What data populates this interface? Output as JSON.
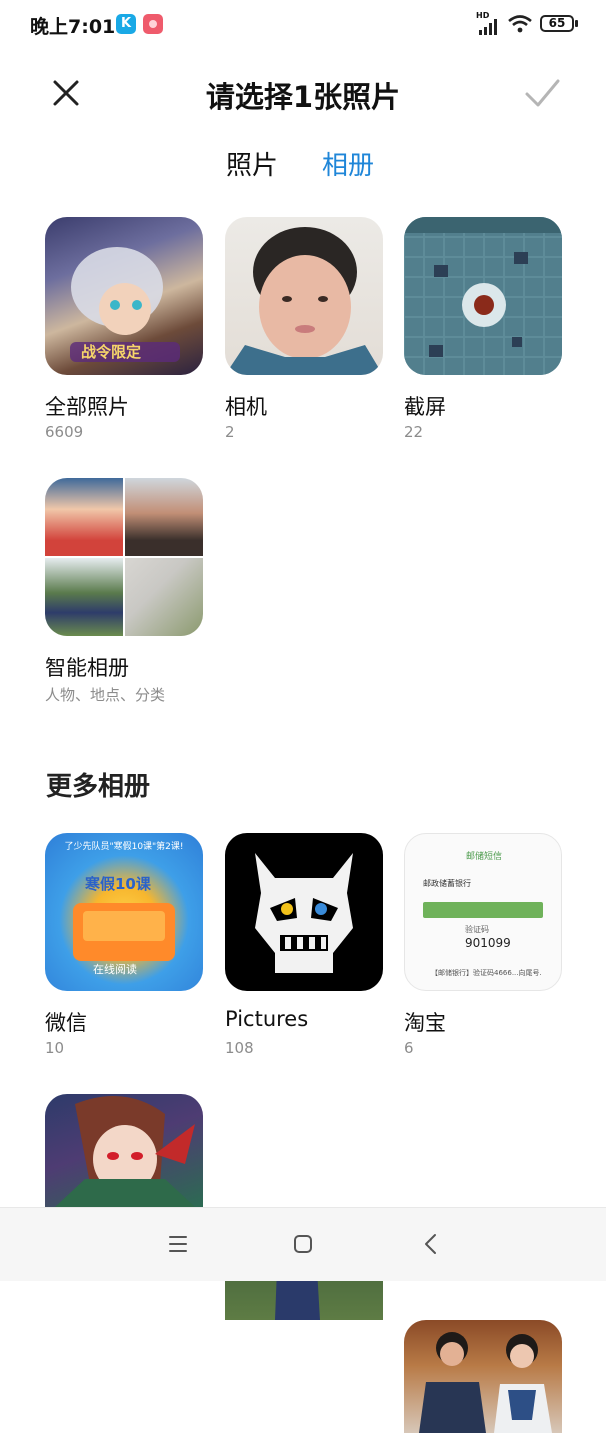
{
  "status_bar": {
    "time": "晚上7:01",
    "app_k_label": "K",
    "network": "HD",
    "battery": "65"
  },
  "header": {
    "title": "请选择1张照片"
  },
  "tabs": {
    "photos": "照片",
    "albums": "相册",
    "active": "相册"
  },
  "albums": [
    {
      "name": "全部照片",
      "count": "6609"
    },
    {
      "name": "相机",
      "count": "2"
    },
    {
      "name": "截屏",
      "count": "22"
    },
    {
      "name": "智能相册",
      "count": "人物、地点、分类"
    }
  ],
  "more_albums": {
    "title": "更多相册",
    "items": [
      {
        "name": "微信",
        "count": "10"
      },
      {
        "name": "Pictures",
        "count": "108"
      },
      {
        "name": "淘宝",
        "count": "6"
      }
    ]
  },
  "thumb_text": {
    "all_banner": "战令限定",
    "wechat_top": "了少先队员\"寒假10课\"第2课!",
    "wechat_badge": "寒假10课",
    "wechat_btn": "在线阅读",
    "taobao_title": "邮储短信",
    "taobao_bank": "邮政储蓄银行",
    "taobao_code_label": "验证码",
    "taobao_code": "901099",
    "taobao_msg": "【邮储银行】验证码4666...向尾号..."
  },
  "colors": {
    "accent": "#1f86d8",
    "text": "#111111",
    "secondary": "#8c8c8c"
  }
}
